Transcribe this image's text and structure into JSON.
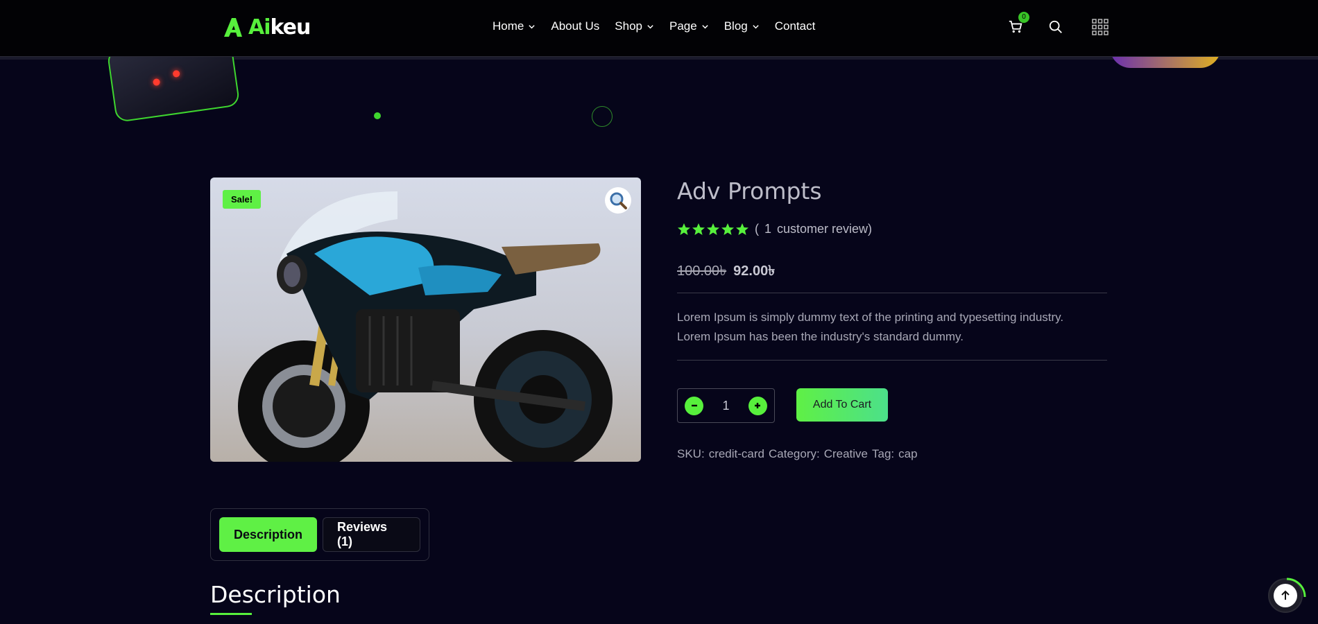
{
  "header": {
    "logo": {
      "ai": "Ai",
      "rest": "keu"
    },
    "nav": [
      {
        "label": "Home",
        "has_dropdown": true
      },
      {
        "label": "About Us",
        "has_dropdown": false
      },
      {
        "label": "Shop",
        "has_dropdown": true
      },
      {
        "label": "Page",
        "has_dropdown": true
      },
      {
        "label": "Blog",
        "has_dropdown": true
      },
      {
        "label": "Contact",
        "has_dropdown": false
      }
    ],
    "cart_count": "0",
    "icons": [
      "cart-icon",
      "search-icon",
      "grid-menu-icon"
    ]
  },
  "product": {
    "sale_badge": "Sale!",
    "title": "Adv Prompts",
    "rating": 5,
    "review_count": "1",
    "review_label": "customer review)",
    "review_open": "(",
    "price_old": "100.00৳",
    "price_new": "92.00৳",
    "description_line1": "Lorem Ipsum is simply dummy text of the printing and typesetting industry.",
    "description_line2": "Lorem Ipsum has been the industry's standard dummy.",
    "quantity": "1",
    "add_to_cart": "Add To Cart",
    "sku_label": "SKU:",
    "sku": "credit-card",
    "category_label": "Category:",
    "category": "Creative",
    "tag_label": "Tag:",
    "tag": "cap"
  },
  "tabs": [
    {
      "label": "Description",
      "active": true
    },
    {
      "label": "Reviews (1)",
      "active": false
    }
  ],
  "section_heading": "Description",
  "colors": {
    "accent": "#57f03c",
    "background": "#06051a",
    "header_bg": "#020205"
  }
}
